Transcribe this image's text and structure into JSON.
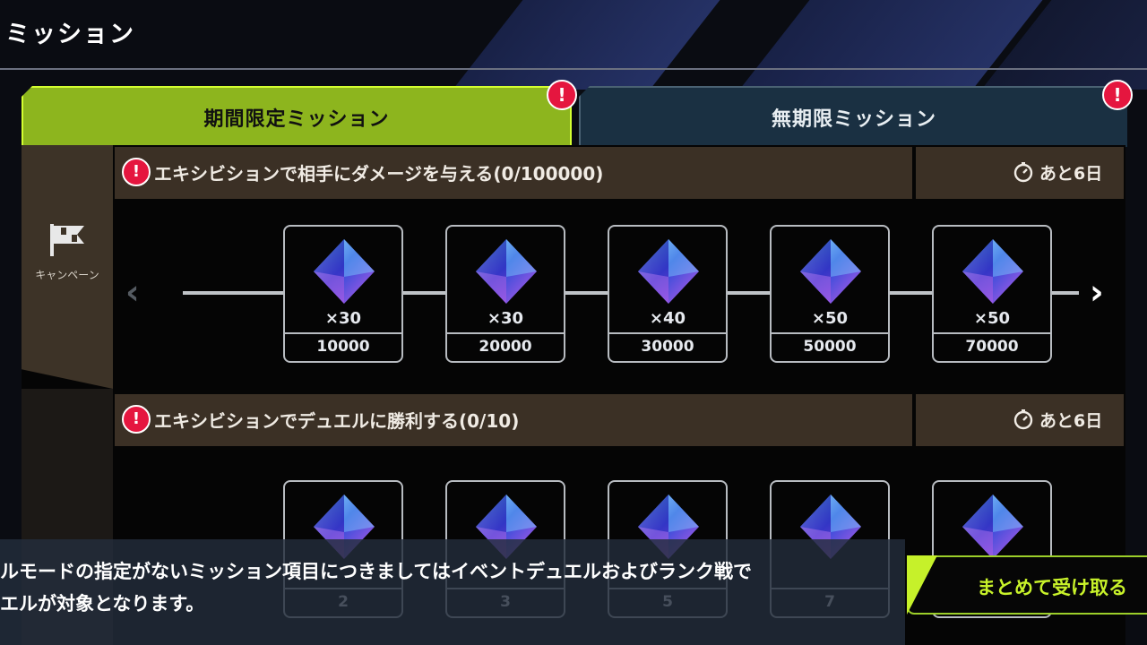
{
  "header": {
    "title": "ミッション"
  },
  "tabs": [
    {
      "label": "期間限定ミッション",
      "active": true,
      "alert": "!"
    },
    {
      "label": "無期限ミッション",
      "active": false,
      "alert": "!"
    }
  ],
  "sidebar": {
    "label": "キャンペーン",
    "icon": "flag-icon"
  },
  "missions": [
    {
      "alert": "!",
      "title": "エキシビションで相手にダメージを与える(0/100000)",
      "time_left": "あと6日",
      "rewards": [
        {
          "qty": "×30",
          "goal": "10000"
        },
        {
          "qty": "×30",
          "goal": "20000"
        },
        {
          "qty": "×40",
          "goal": "30000"
        },
        {
          "qty": "×50",
          "goal": "50000"
        },
        {
          "qty": "×50",
          "goal": "70000"
        }
      ]
    },
    {
      "alert": "!",
      "title": "エキシビションでデュエルに勝利する(0/10)",
      "time_left": "あと6日",
      "rewards": [
        {
          "goal": "2"
        },
        {
          "goal": "3"
        },
        {
          "goal": "5"
        },
        {
          "goal": "7"
        },
        {
          "goal": ""
        }
      ]
    }
  ],
  "nav": {
    "prev": "‹",
    "next": "›"
  },
  "notice": {
    "line1": "ルモードの指定がないミッション項目につきましてはイベントデュエルおよびランク戦で",
    "line2": "エルが対象となります。"
  },
  "claim_all_button": "まとめて受け取る",
  "colors": {
    "active_tab": "#8db51e",
    "inactive_tab": "#1a3042",
    "alert": "#e5163f",
    "claim_text": "#c8f22a"
  }
}
